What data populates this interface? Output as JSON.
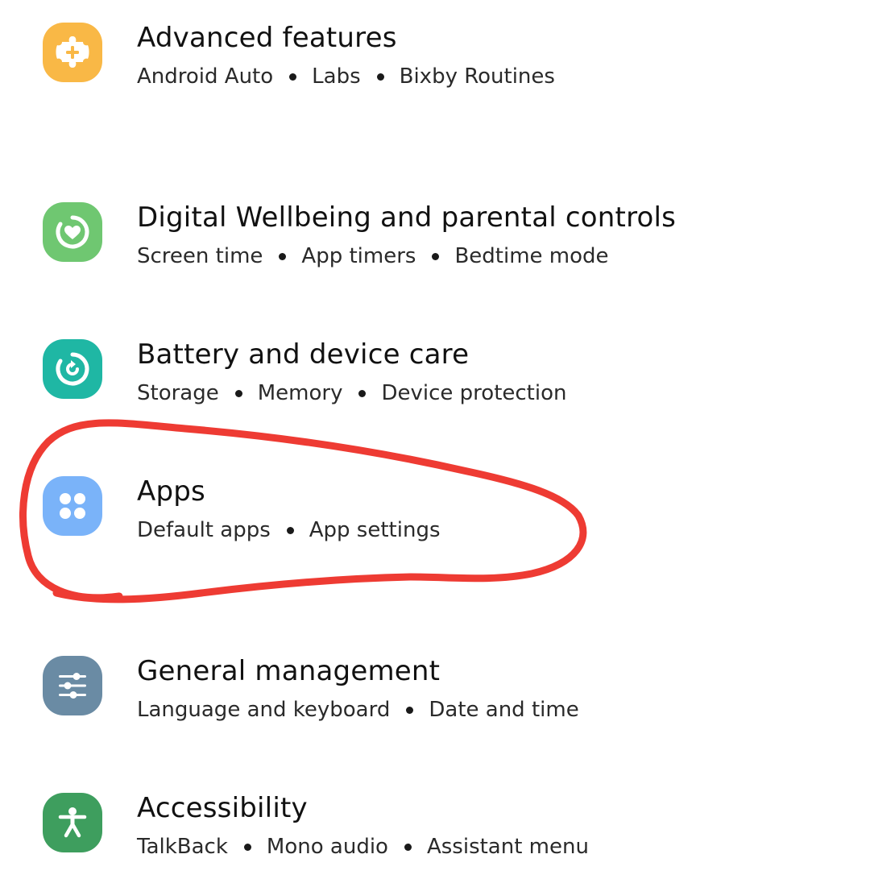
{
  "settings": {
    "items": [
      {
        "id": "advanced-features",
        "title": "Advanced features",
        "subtitles": [
          "Android Auto",
          "Labs",
          "Bixby Routines"
        ],
        "icon": "puzzle-plus-icon",
        "color": "#F9B846"
      },
      {
        "id": "digital-wellbeing",
        "title": "Digital Wellbeing and parental controls",
        "subtitles": [
          "Screen time",
          "App timers",
          "Bedtime mode"
        ],
        "icon": "heart-ring-icon",
        "color": "#6FC771"
      },
      {
        "id": "battery",
        "title": "Battery and device care",
        "subtitles": [
          "Storage",
          "Memory",
          "Device protection"
        ],
        "icon": "device-care-icon",
        "color": "#1FB7A4"
      },
      {
        "id": "apps",
        "title": "Apps",
        "subtitles": [
          "Default apps",
          "App settings"
        ],
        "icon": "apps-grid-icon",
        "color": "#7AB3F9"
      },
      {
        "id": "general-management",
        "title": "General management",
        "subtitles": [
          "Language and keyboard",
          "Date and time"
        ],
        "icon": "sliders-icon",
        "color": "#6A8BA4"
      },
      {
        "id": "accessibility",
        "title": "Accessibility",
        "subtitles": [
          "TalkBack",
          "Mono audio",
          "Assistant menu"
        ],
        "icon": "accessibility-person-icon",
        "color": "#3E9E5E"
      }
    ]
  },
  "annotation": {
    "shape": "hand-drawn-ellipse",
    "target": "apps",
    "color": "#EE3B33"
  }
}
